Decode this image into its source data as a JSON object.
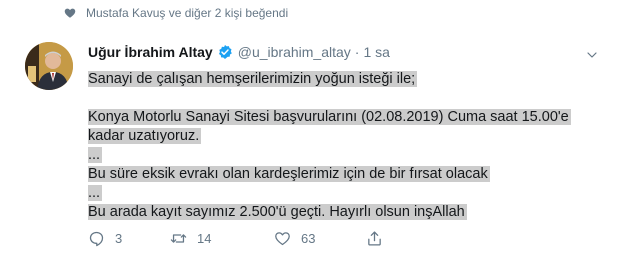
{
  "social_context": "Mustafa Kavuş ve diğer 2 kişi beğendi",
  "author": {
    "name": "Uğur İbrahim Altay",
    "handle": "@u_ibrahim_altay",
    "separator": "·",
    "time": "1 sa"
  },
  "tweet_lines": [
    "Sanayi de çalışan hemşerilerimizin yoğun isteği ile;",
    "",
    "Konya Motorlu Sanayi Sitesi başvurularını (02.08.2019) Cuma saat 15.00'e",
    "kadar uzatıyoruz.",
    "...",
    "Bu süre eksik evrakı olan kardeşlerimiz için de bir fırsat olacak",
    "...",
    "Bu arada kayıt sayımız 2.500'ü geçti. Hayırlı olsun inşAllah"
  ],
  "actions": {
    "reply_count": "3",
    "retweet_count": "14",
    "like_count": "63"
  },
  "colors": {
    "verified": "#1da1f2",
    "muted": "#657786",
    "highlight": "#cccccc"
  }
}
